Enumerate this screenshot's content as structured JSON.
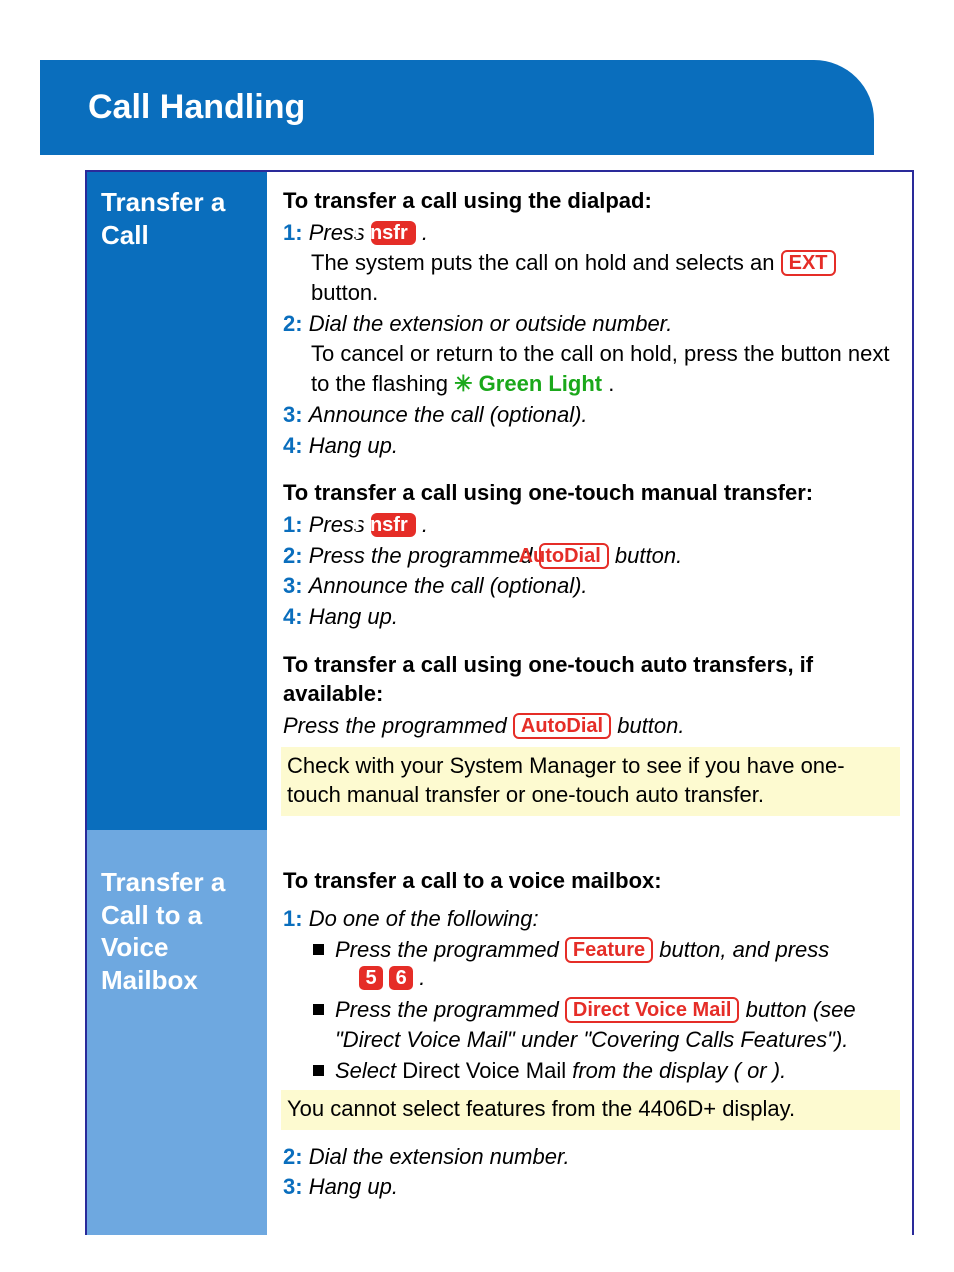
{
  "title": "Call Handling",
  "sections": [
    {
      "heading": "Transfer a Call",
      "blocks": [
        {
          "headline": "To transfer a call using the dialpad:",
          "steps": [
            {
              "n": "1:",
              "lead": "Press ",
              "key_filled": "Trnsfr",
              "trail_it": " .",
              "sub": "The system puts the call on hold and selects an ",
              "sub_key_outline": "EXT",
              "sub_trail": " button."
            },
            {
              "n": "2:",
              "lead": "Dial the extension or outside number.",
              "sub_plain": "To cancel or return to the call on hold, press the button next to the flashing ",
              "green_star": "✳",
              "green_text": " Green Light",
              "sub_tail": "."
            },
            {
              "n": "3:",
              "lead": "Announce the call (optional)."
            },
            {
              "n": "4:",
              "lead": "Hang up."
            }
          ]
        },
        {
          "headline": "To transfer a call using one-touch manual transfer:",
          "steps": [
            {
              "n": "1:",
              "lead": "Press ",
              "key_filled": "Trnsfr",
              "trail_it": " ."
            },
            {
              "n": "2:",
              "lead": "Press the programmed  ",
              "key_outline": "AutoDial",
              "trail_it2": "  button."
            },
            {
              "n": "3:",
              "lead": "Announce the call (optional)."
            },
            {
              "n": "4:",
              "lead": "Hang up."
            }
          ]
        },
        {
          "headline": "To transfer a call using one-touch auto transfers, if available:",
          "plain_it": "Press the programmed  ",
          "plain_key_outline": "AutoDial",
          "plain_trail": "  button."
        }
      ],
      "note": "Check with your System Manager to see if you have one-touch manual transfer or one-touch auto transfer."
    },
    {
      "heading": "Transfer a Call to a Voice Mailbox",
      "headline": "To transfer a call to a voice mailbox:",
      "step1": {
        "n": "1:",
        "text": "Do one of the following:"
      },
      "bullets": [
        {
          "pre": "Press the programmed  ",
          "key_outline": "Feature",
          "mid": "  button, and press ",
          "d1": "5",
          "d2": "6",
          "tail": " ."
        },
        {
          "pre": "Press the programmed  ",
          "key_outline": "Direct Voice Mail",
          "mid2": "  button (see \"Direct Voice Mail\" under \"Covering Calls Features\")."
        },
        {
          "sel1": "Select ",
          "plain": "Direct Voice Mail",
          "sel2": " from the display (          or        )."
        }
      ],
      "note2": "You cannot select features from the 4406D+ display.",
      "step2": {
        "n": "2:",
        "text": "Dial the extension number."
      },
      "step3": {
        "n": "3:",
        "text": "Hang up."
      }
    }
  ]
}
